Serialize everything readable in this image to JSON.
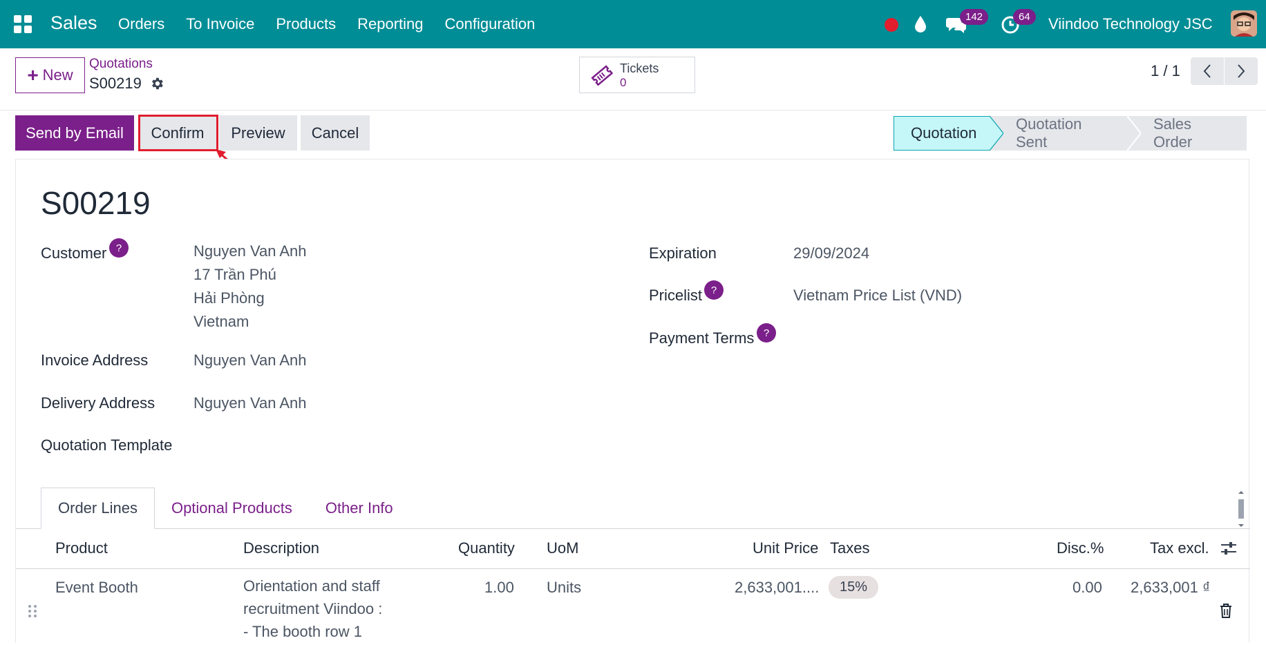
{
  "navbar": {
    "brand": "Sales",
    "menu": [
      "Orders",
      "To Invoice",
      "Products",
      "Reporting",
      "Configuration"
    ],
    "messages_count": "142",
    "activities_count": "64",
    "company": "Viindoo Technology JSC"
  },
  "control_panel": {
    "new_label": "New",
    "breadcrumb_parent": "Quotations",
    "breadcrumb_current": "S00219",
    "smart_button": {
      "label": "Tickets",
      "value": "0"
    },
    "pager": "1 / 1"
  },
  "actions": {
    "send_by_email": "Send by Email",
    "confirm": "Confirm",
    "preview": "Preview",
    "cancel": "Cancel"
  },
  "statusbar": {
    "stages": [
      "Quotation",
      "Quotation Sent",
      "Sales Order"
    ],
    "active": "Quotation"
  },
  "form": {
    "name": "S00219",
    "customer_label": "Customer",
    "customer_lines": [
      "Nguyen Van Anh",
      "17 Trần Phú",
      "Hải Phòng",
      "Vietnam"
    ],
    "invoice_address_label": "Invoice Address",
    "invoice_address": "Nguyen Van Anh",
    "delivery_address_label": "Delivery Address",
    "delivery_address": "Nguyen Van Anh",
    "quotation_template_label": "Quotation Template",
    "expiration_label": "Expiration",
    "expiration": "29/09/2024",
    "pricelist_label": "Pricelist",
    "pricelist": "Vietnam Price List (VND)",
    "payment_terms_label": "Payment Terms",
    "help_mark": "?"
  },
  "tabs": [
    "Order Lines",
    "Optional Products",
    "Other Info"
  ],
  "order_lines": {
    "columns": [
      "Product",
      "Description",
      "Quantity",
      "UoM",
      "Unit Price",
      "Taxes",
      "Disc.%",
      "Tax excl."
    ],
    "rows": [
      {
        "product": "Event Booth",
        "description": [
          "Orientation and staff",
          "recruitment Viindoo :",
          "- The booth row 1"
        ],
        "quantity": "1.00",
        "uom": "Units",
        "unit_price": "2,633,001....",
        "taxes": "15%",
        "discount": "0.00",
        "subtotal": "2,633,001 ₫"
      }
    ]
  },
  "colors": {
    "navbar": "#018d96",
    "primary": "#7b1f8a",
    "highlight": "#e11d2e",
    "stage_active": "#c5f6f8"
  }
}
